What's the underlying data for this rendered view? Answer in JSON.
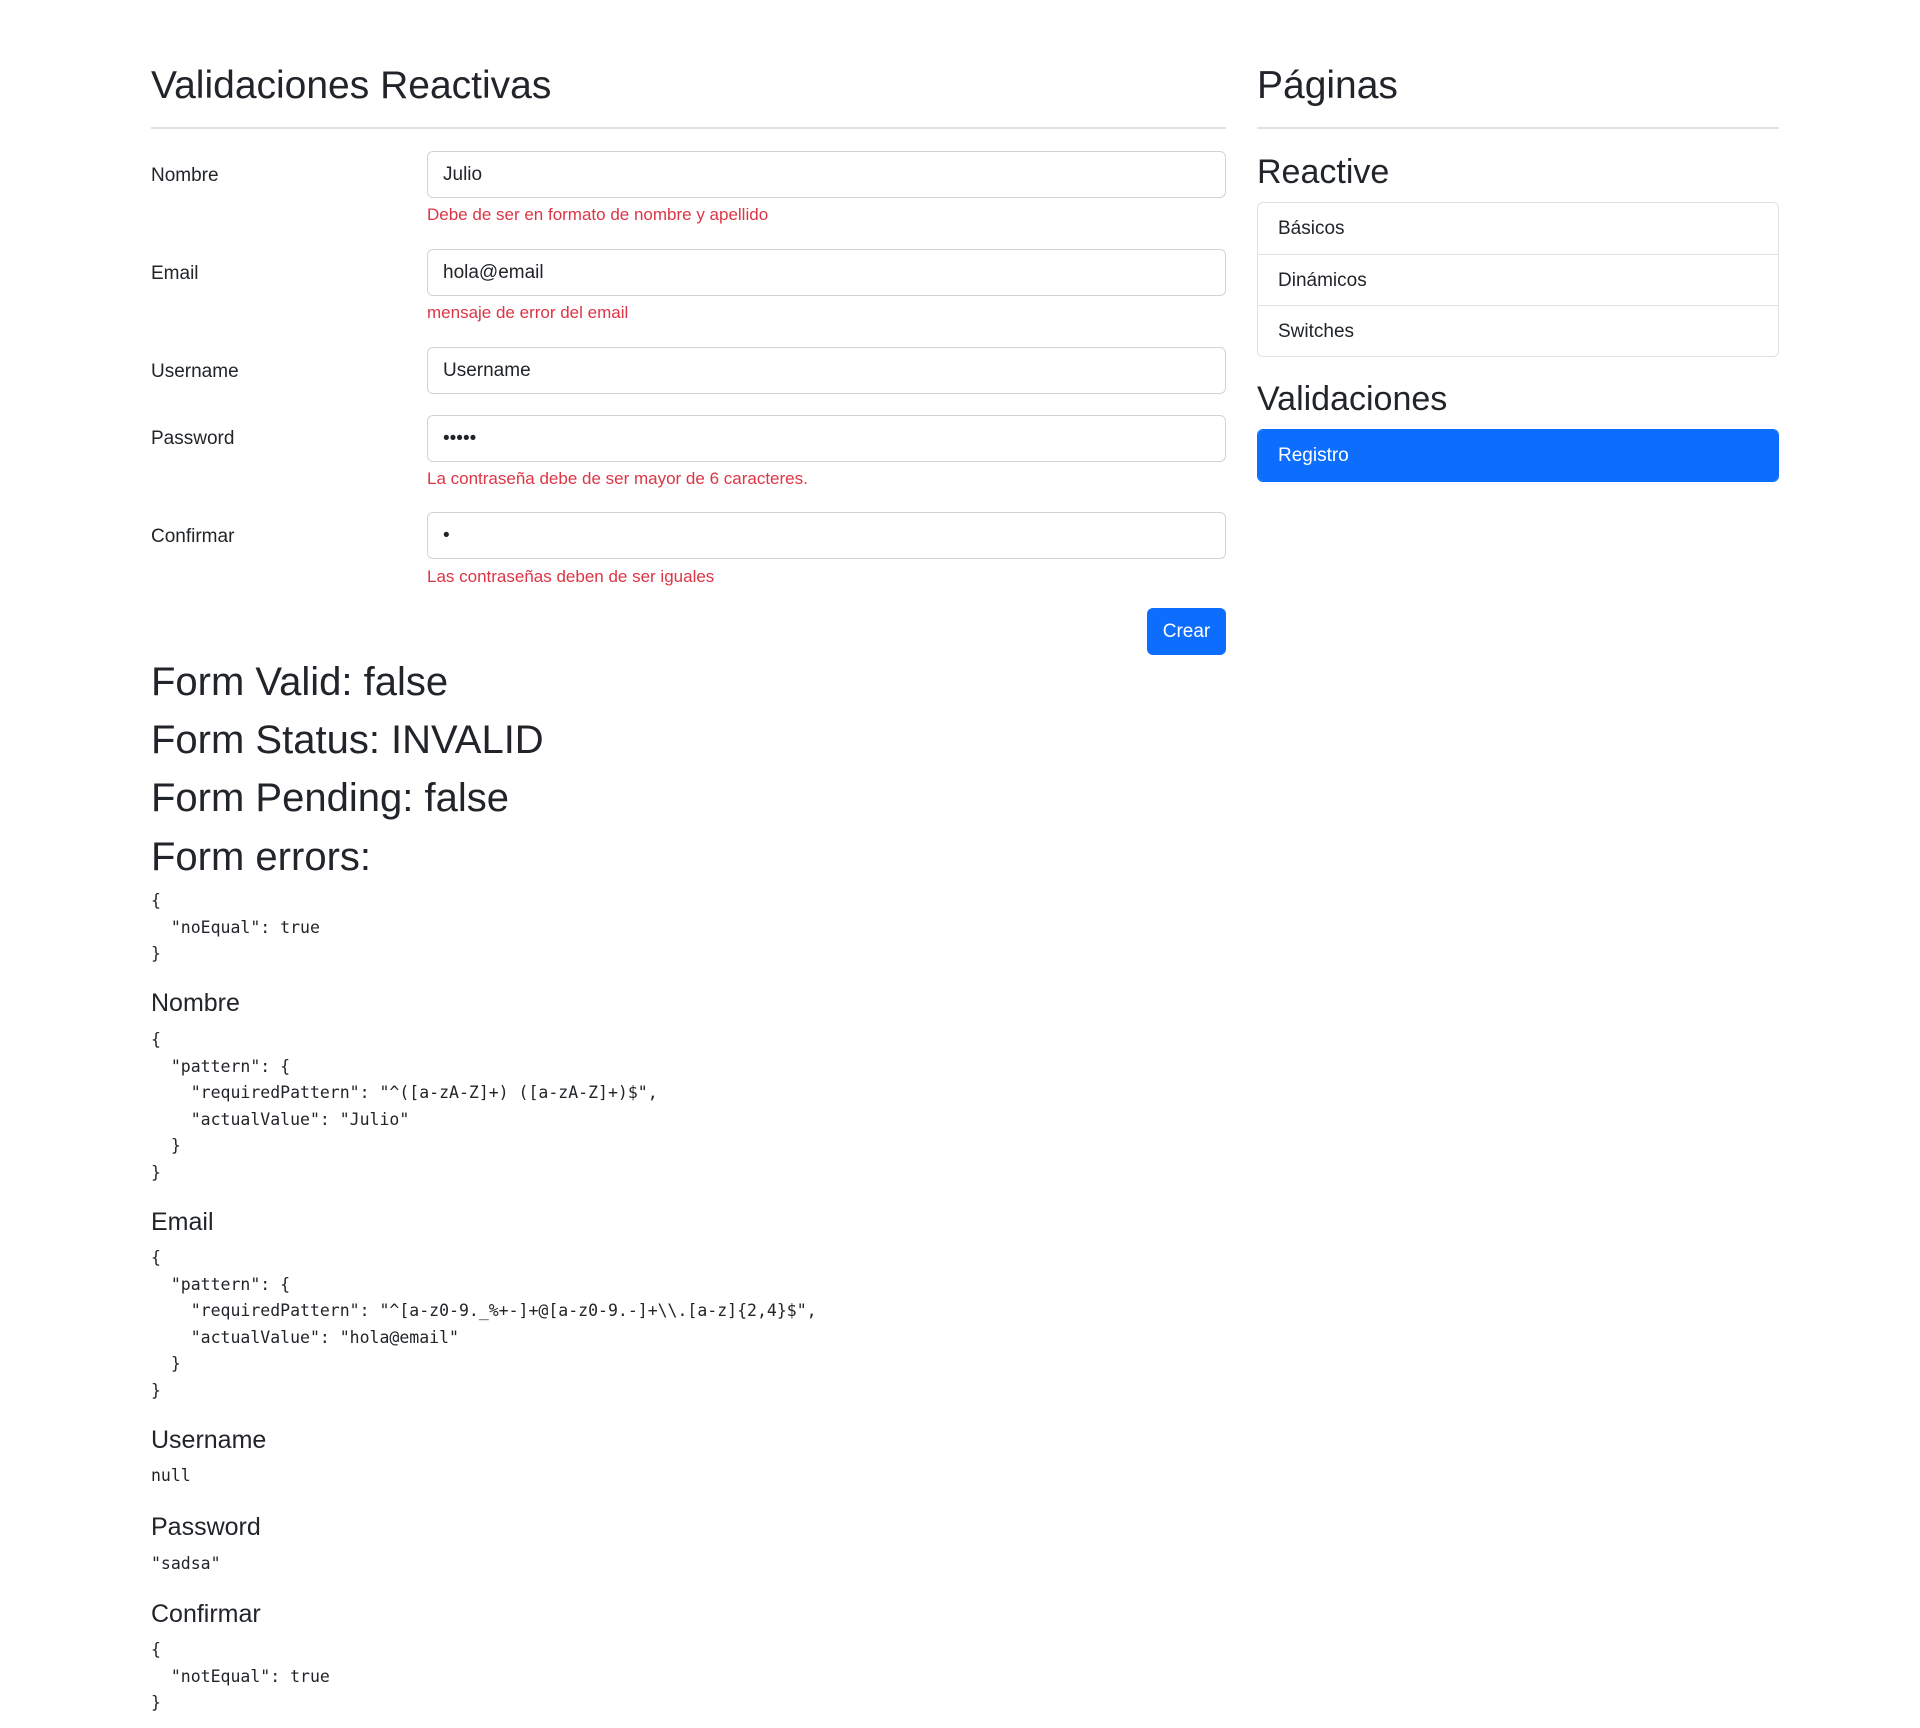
{
  "form": {
    "title": "Validaciones Reactivas",
    "fields": [
      {
        "label": "Nombre",
        "value": "Julio",
        "error": "Debe de ser en formato de nombre y apellido"
      },
      {
        "label": "Email",
        "value": "hola@email",
        "error": "mensaje de error del email"
      },
      {
        "label": "Username",
        "value": "Username",
        "error": ""
      },
      {
        "label": "Password",
        "value": "•••••",
        "error": "La contraseña debe de ser mayor de 6 caracteres."
      },
      {
        "label": "Confirmar",
        "value": "•",
        "error": "Las contraseñas deben de ser iguales"
      }
    ],
    "submit_label": "Crear"
  },
  "status": {
    "valid": "Form Valid: false",
    "status": "Form Status: INVALID",
    "pending": "Form Pending: false",
    "errors_title": "Form errors:",
    "errors_json": "{\n  \"noEqual\": true\n}"
  },
  "controls": [
    {
      "title": "Nombre",
      "json": "{\n  \"pattern\": {\n    \"requiredPattern\": \"^([a-zA-Z]+) ([a-zA-Z]+)$\",\n    \"actualValue\": \"Julio\"\n  }\n}"
    },
    {
      "title": "Email",
      "json": "{\n  \"pattern\": {\n    \"requiredPattern\": \"^[a-z0-9._%+-]+@[a-z0-9.-]+\\\\.[a-z]{2,4}$\",\n    \"actualValue\": \"hola@email\"\n  }\n}"
    },
    {
      "title": "Username",
      "json": "null"
    },
    {
      "title": "Password",
      "json": "\"sadsa\""
    },
    {
      "title": "Confirmar",
      "json": "{\n  \"notEqual\": true\n}"
    }
  ],
  "sidebar": {
    "title": "Páginas",
    "groups": [
      {
        "heading": "Reactive",
        "items": [
          "Básicos",
          "Dinámicos",
          "Switches"
        ]
      },
      {
        "heading": "Validaciones",
        "items": [
          "Registro"
        ],
        "active_item": "Registro"
      }
    ]
  },
  "colors": {
    "primary": "#0d6efd",
    "danger": "#dc3545",
    "text": "#212529",
    "border": "#dee2e6"
  }
}
